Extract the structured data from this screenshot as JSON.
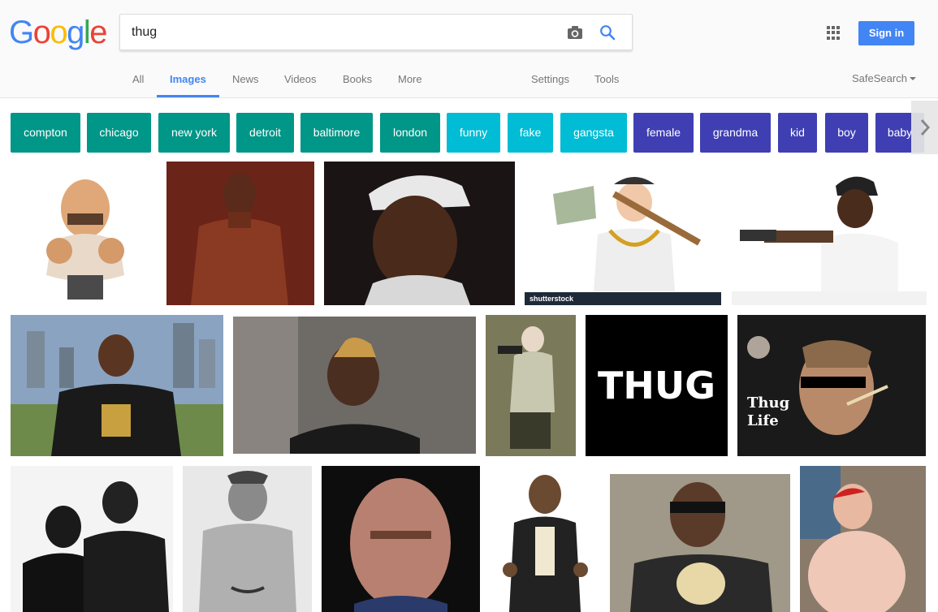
{
  "logo": {
    "letters": [
      {
        "ch": "G",
        "color": "#4285f4"
      },
      {
        "ch": "o",
        "color": "#ea4335"
      },
      {
        "ch": "o",
        "color": "#fbbc05"
      },
      {
        "ch": "g",
        "color": "#4285f4"
      },
      {
        "ch": "l",
        "color": "#34a853"
      },
      {
        "ch": "e",
        "color": "#ea4335"
      }
    ]
  },
  "search": {
    "value": "thug"
  },
  "header": {
    "signin_label": "Sign in"
  },
  "tabs": {
    "all": "All",
    "images": "Images",
    "news": "News",
    "videos": "Videos",
    "books": "Books",
    "more": "More",
    "settings": "Settings",
    "tools": "Tools",
    "safesearch": "SafeSearch"
  },
  "chips": [
    {
      "label": "compton",
      "color": "#009688"
    },
    {
      "label": "chicago",
      "color": "#009688"
    },
    {
      "label": "new york",
      "color": "#009688"
    },
    {
      "label": "detroit",
      "color": "#009688"
    },
    {
      "label": "baltimore",
      "color": "#009688"
    },
    {
      "label": "london",
      "color": "#009688"
    },
    {
      "label": "funny",
      "color": "#00bcd4"
    },
    {
      "label": "fake",
      "color": "#00bcd4"
    },
    {
      "label": "gangsta",
      "color": "#00bcd4"
    },
    {
      "label": "female",
      "color": "#3f3fb3"
    },
    {
      "label": "grandma",
      "color": "#3f3fb3"
    },
    {
      "label": "kid",
      "color": "#3f3fb3"
    },
    {
      "label": "boy",
      "color": "#3f3fb3"
    },
    {
      "label": "baby",
      "color": "#3f3fb3"
    }
  ],
  "results": {
    "thug_word": "THUG",
    "shutterstock": "shutterstock",
    "thug_life": "Thug Life"
  }
}
